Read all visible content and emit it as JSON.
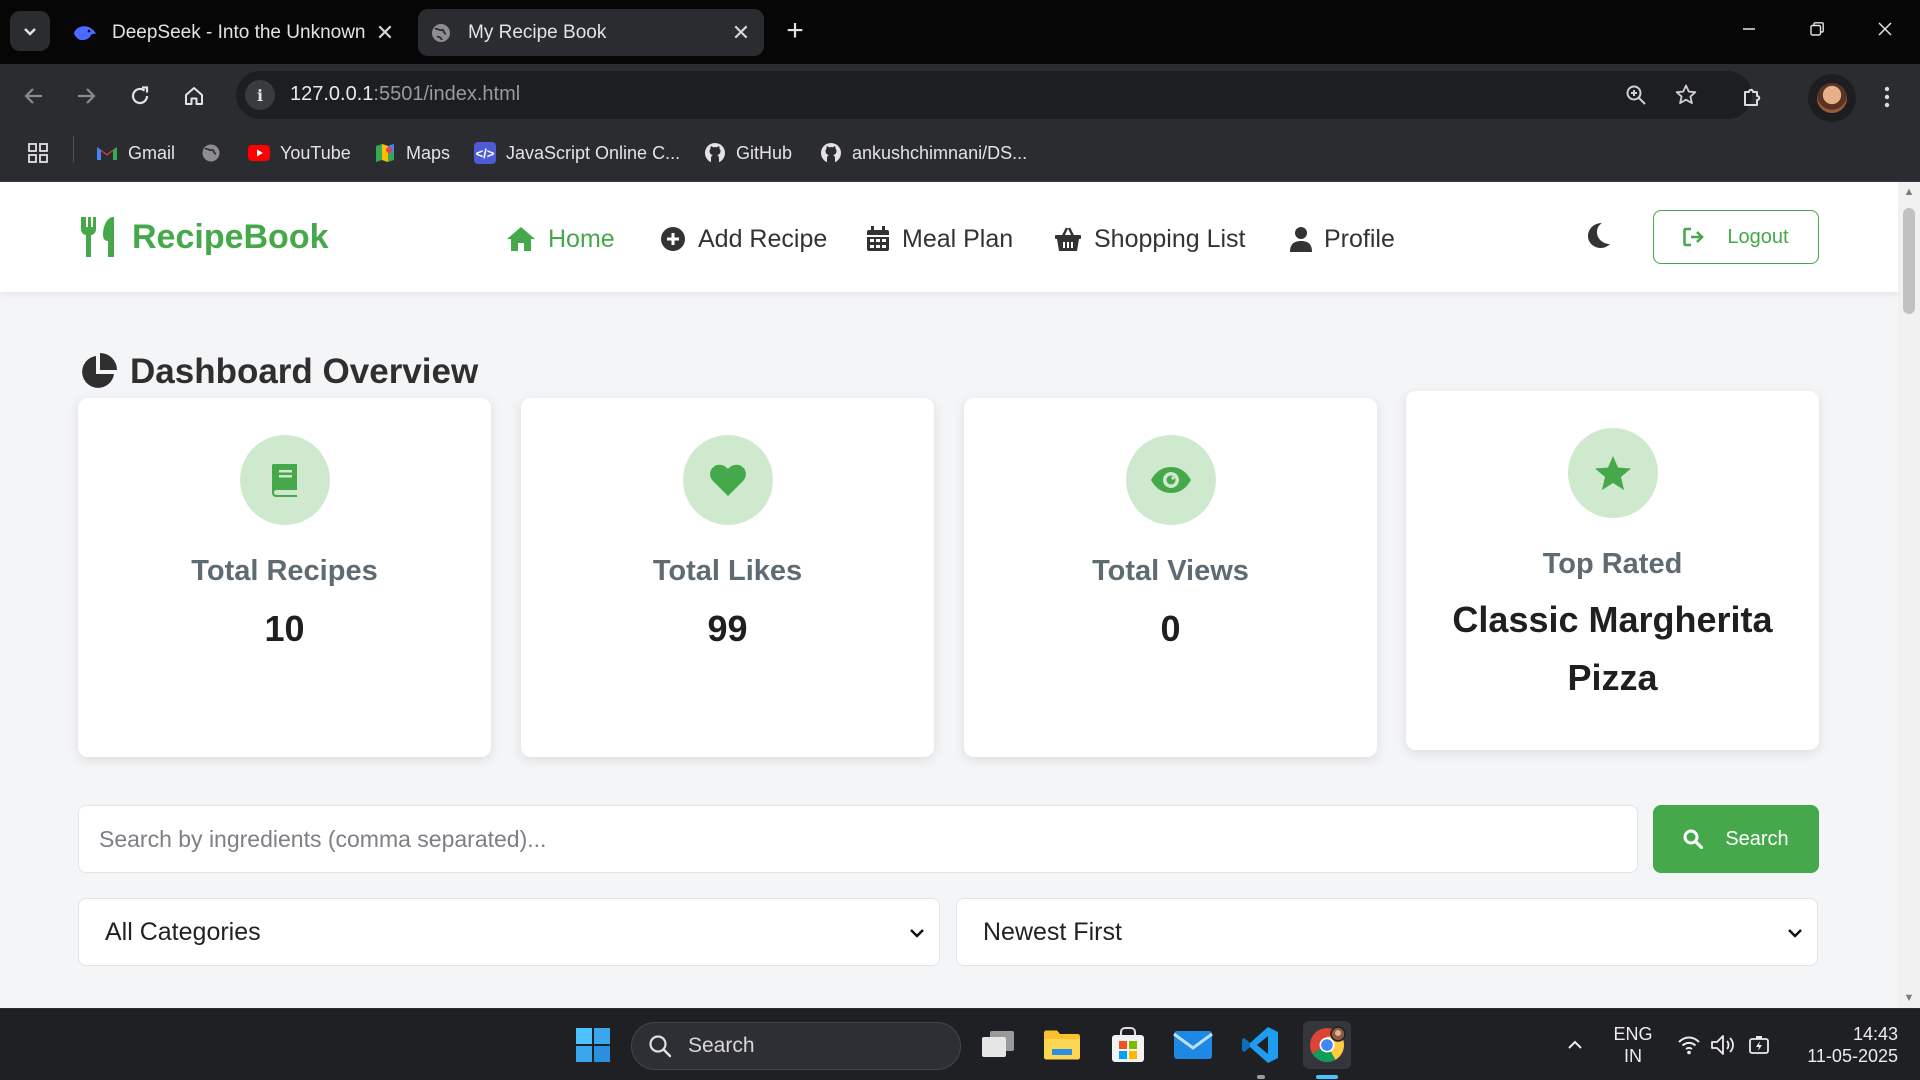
{
  "browser": {
    "tabs": [
      {
        "title": "DeepSeek - Into the Unknown",
        "icon": "deepseek-whale-icon",
        "active": false
      },
      {
        "title": "My Recipe Book",
        "icon": "globe-icon",
        "active": true
      }
    ],
    "url_host": "127.0.0.1",
    "url_rest": ":5501/index.html",
    "bookmarks": [
      {
        "label": "Gmail",
        "icon": "gmail-icon"
      },
      {
        "label": "",
        "icon": "globe-icon"
      },
      {
        "label": "YouTube",
        "icon": "youtube-icon"
      },
      {
        "label": "Maps",
        "icon": "maps-icon"
      },
      {
        "label": "JavaScript Online C...",
        "icon": "code-icon"
      },
      {
        "label": "GitHub",
        "icon": "github-icon"
      },
      {
        "label": "ankushchimnani/DS...",
        "icon": "github-icon"
      }
    ]
  },
  "app": {
    "brand": "RecipeBook",
    "accent_color": "#45a84a",
    "nav": [
      {
        "label": "Home",
        "icon": "home-icon",
        "active": true
      },
      {
        "label": "Add Recipe",
        "icon": "plus-circle-icon",
        "active": false
      },
      {
        "label": "Meal Plan",
        "icon": "calendar-icon",
        "active": false
      },
      {
        "label": "Shopping List",
        "icon": "basket-icon",
        "active": false
      },
      {
        "label": "Profile",
        "icon": "user-icon",
        "active": false
      }
    ],
    "logout_label": "Logout"
  },
  "dashboard": {
    "title": "Dashboard Overview",
    "cards": [
      {
        "label": "Total Recipes",
        "value": "10",
        "icon": "book-icon"
      },
      {
        "label": "Total Likes",
        "value": "99",
        "icon": "heart-icon"
      },
      {
        "label": "Total Views",
        "value": "0",
        "icon": "eye-icon"
      },
      {
        "label": "Top Rated",
        "value": "Classic Margherita Pizza",
        "icon": "star-icon"
      }
    ]
  },
  "search": {
    "placeholder": "Search by ingredients (comma separated)...",
    "value": "",
    "button_label": "Search"
  },
  "filters": {
    "category_selected": "All Categories",
    "sort_selected": "Newest First"
  },
  "taskbar": {
    "search_label": "Search",
    "lang_top": "ENG",
    "lang_bottom": "IN",
    "time": "14:43",
    "date": "11-05-2025"
  }
}
